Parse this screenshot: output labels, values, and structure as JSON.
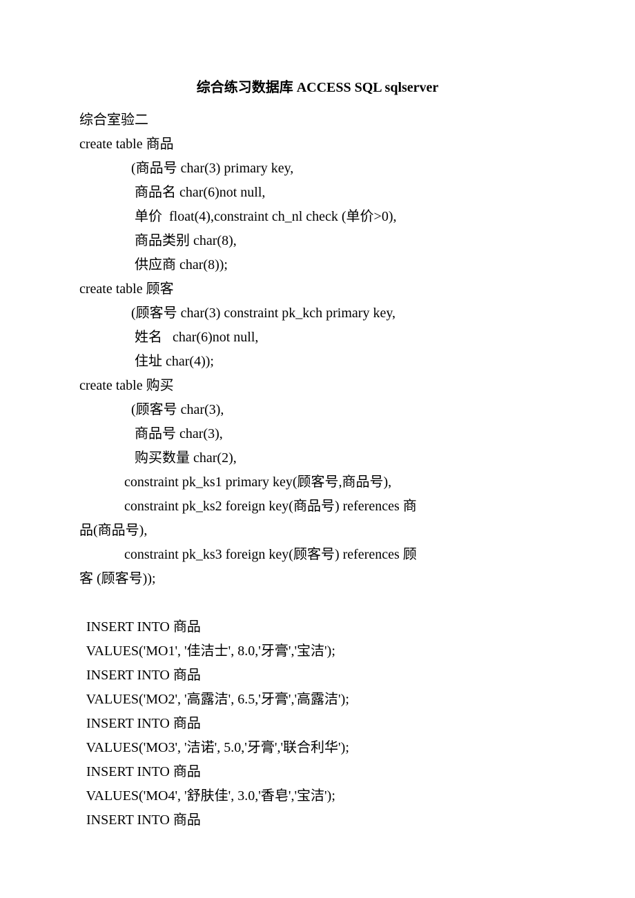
{
  "title": "综合练习数据库 ACCESS SQL  sqlserver",
  "lines": [
    "综合室验二",
    "create table 商品",
    "               (商品号 char(3) primary key,",
    "                商品名 char(6)not null,",
    "                单价  float(4),constraint ch_nl check (单价>0),",
    "                商品类别 char(8),",
    "                供应商 char(8));",
    "create table 顾客",
    "               (顾客号 char(3) constraint pk_kch primary key,",
    "                姓名   char(6)not null,",
    "                住址 char(4));",
    "create table 购买",
    "               (顾客号 char(3),",
    "                商品号 char(3),",
    "                购买数量 char(2),",
    "             constraint pk_ks1 primary key(顾客号,商品号),",
    "             constraint pk_ks2 foreign key(商品号) references 商",
    "品(商品号),",
    "             constraint pk_ks3 foreign key(顾客号) references 顾",
    "客 (顾客号));",
    "",
    "  INSERT INTO 商品",
    "  VALUES('MO1', '佳洁士', 8.0,'牙膏','宝洁');",
    "  INSERT INTO 商品",
    "  VALUES('MO2', '高露洁', 6.5,'牙膏','高露洁');",
    "  INSERT INTO 商品",
    "  VALUES('MO3', '洁诺', 5.0,'牙膏','联合利华');",
    "  INSERT INTO 商品",
    "  VALUES('MO4', '舒肤佳', 3.0,'香皂','宝洁');",
    "  INSERT INTO 商品"
  ]
}
